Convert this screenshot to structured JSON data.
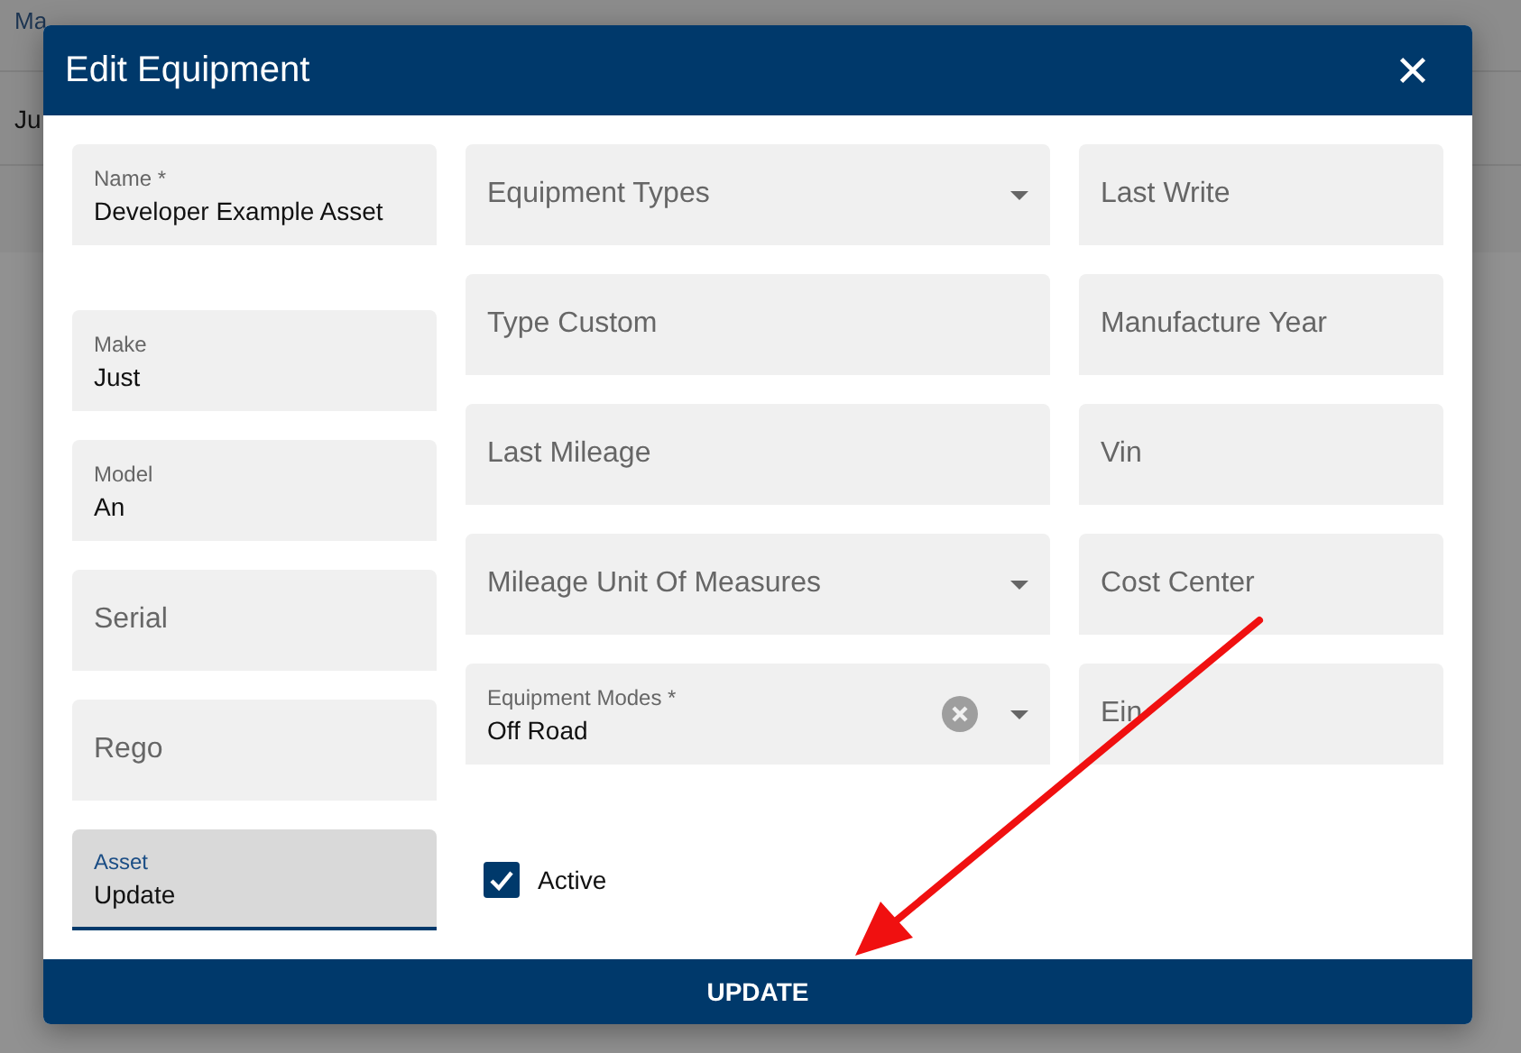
{
  "background": {
    "header": "Ma",
    "row": "Ju"
  },
  "dialog": {
    "title": "Edit Equipment",
    "columns": [
      [
        {
          "kind": "text",
          "label": "Name *",
          "value": "Developer Example Asset",
          "focused": false
        },
        {
          "kind": "text",
          "label": "Make",
          "value": "Just",
          "focused": false
        },
        {
          "kind": "text",
          "label": "Model",
          "value": "An",
          "focused": false
        },
        {
          "kind": "text",
          "label": "Serial",
          "focused": false
        },
        {
          "kind": "text",
          "label": "Rego",
          "focused": false
        },
        {
          "kind": "text",
          "label": "Asset",
          "value": "Update",
          "focused": true
        }
      ],
      [
        {
          "kind": "select",
          "label": "Equipment Types",
          "clearable": false
        },
        {
          "kind": "text",
          "label": "Type Custom",
          "focused": false
        },
        {
          "kind": "text",
          "label": "Last Mileage",
          "focused": false
        },
        {
          "kind": "select",
          "label": "Mileage Unit Of Measures",
          "clearable": false
        },
        {
          "kind": "select",
          "label": "Equipment Modes *",
          "value": "Off Road",
          "clearable": true
        },
        {
          "kind": "checkbox",
          "label": "Active",
          "checked": true
        }
      ],
      [
        {
          "kind": "text",
          "label": "Last Write",
          "focused": false
        },
        {
          "kind": "text",
          "label": "Manufacture Year",
          "focused": false
        },
        {
          "kind": "text",
          "label": "Vin",
          "focused": false
        },
        {
          "kind": "text",
          "label": "Cost Center",
          "focused": false
        },
        {
          "kind": "text",
          "label": "Ein",
          "focused": false
        }
      ]
    ],
    "button": "UPDATE"
  }
}
